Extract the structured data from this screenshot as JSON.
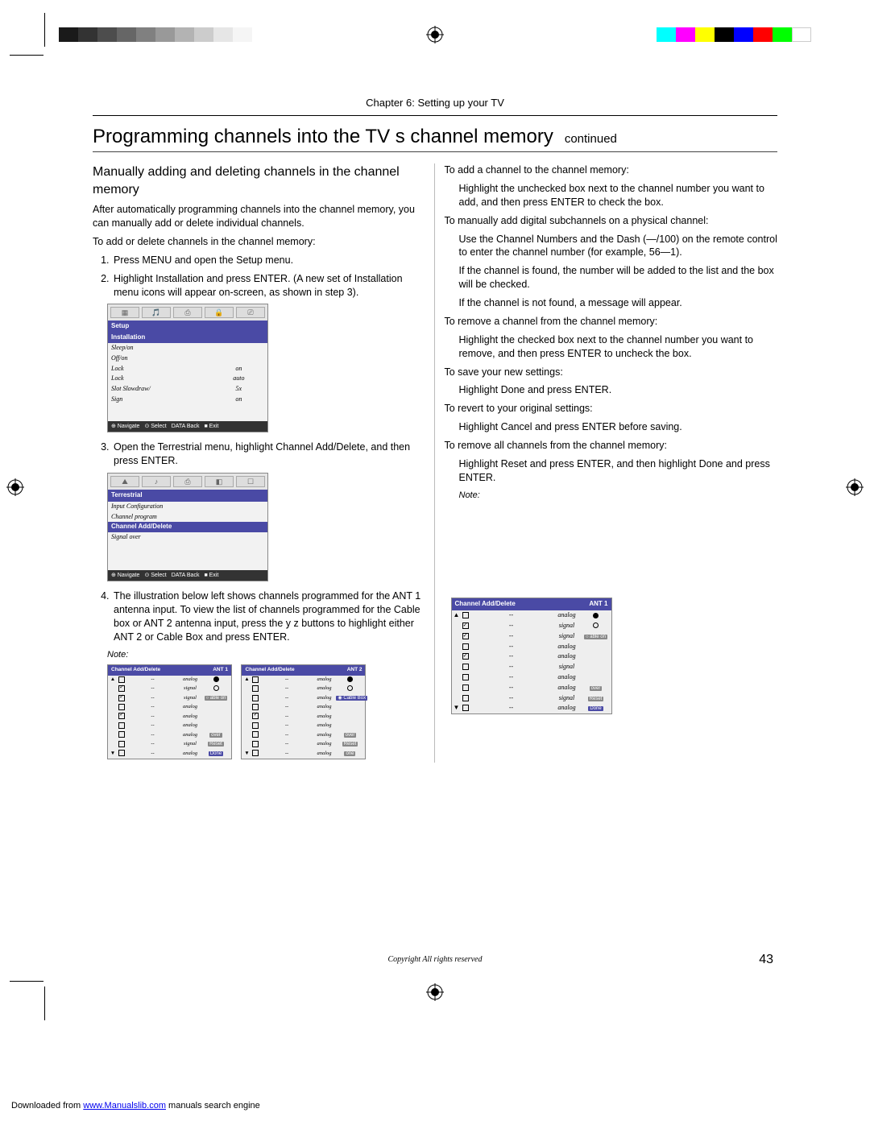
{
  "chapter": "Chapter 6: Setting up your TV",
  "title": "Programming channels into the TV s channel memory",
  "continued": "continued",
  "left": {
    "h3": "Manually adding and deleting channels in the channel memory",
    "intro": "After automatically programming channels into the channel memory, you can manually add or delete individual channels.",
    "lead": "To add or delete channels in the channel memory:",
    "li1": "Press MENU and open the Setup menu.",
    "li2": "Highlight Installation and press ENTER. (A new set of Installation menu icons will appear on-screen, as shown in step 3).",
    "li3": "Open the Terrestrial menu, highlight Channel Add/Delete, and then press ENTER.",
    "li4": "The illustration below left shows channels programmed for the ANT 1 antenna input. To view the list of channels programmed for the Cable box or ANT 2 antenna input, press the y z buttons to highlight either  ANT 2  or  Cable Box  and press ENTER.",
    "note4": "Note:"
  },
  "right": {
    "p1": "To add a channel to the channel memory:",
    "p1b": "Highlight the unchecked box next to the channel number you want to add, and then press ENTER to check the box.",
    "p2": "To manually add digital subchannels on a physical channel:",
    "p2b": "Use the Channel Numbers and the Dash (—/100) on the remote control to enter the channel number (for example, 56—1).",
    "p2c": "If the channel is found, the number will be added to the list and the box will be checked.",
    "p2d": "If the channel is not found, a message will appear.",
    "p3": "To remove a channel from the channel memory:",
    "p3b": "Highlight the checked box next to the channel number you want to remove, and then press ENTER to uncheck the box.",
    "p4": "To save your new settings:",
    "p4b": "Highlight Done and press ENTER.",
    "p5": "To revert to your original settings:",
    "p5b": "Highlight Cancel and press ENTER before saving.",
    "p6": "To remove all channels from the channel memory:",
    "p6b": "Highlight Reset and press ENTER, and then highlight Done and press ENTER.",
    "note": "Note:"
  },
  "menu_setup": {
    "header": "Setup",
    "rows": [
      {
        "c1": "Installation",
        "hl": true
      },
      {
        "c1": "Sleep/on",
        "c2": ""
      },
      {
        "c1": "Off/on",
        "c2": ""
      },
      {
        "c1": "Lock",
        "c2": "on"
      },
      {
        "c1": "Lock",
        "c2": "auto"
      },
      {
        "c1": "Slot Slowdraw/",
        "c2": "5x"
      },
      {
        "c1": "Sign",
        "c2": "on"
      }
    ],
    "footer": [
      "⊕ Navigate",
      "⊙ Select",
      "DATA Back",
      "■ Exit"
    ]
  },
  "menu_terr": {
    "header": "Terrestrial",
    "rows": [
      {
        "c1": "Input Configuration"
      },
      {
        "c1": "Channel program"
      },
      {
        "c1": "Channel Add/Delete",
        "hl": true
      },
      {
        "c1": "Signal over"
      }
    ],
    "footer": [
      "⊕ Navigate",
      "⊙ Select",
      "DATA Back",
      "■ Exit"
    ]
  },
  "table_ant1": {
    "title": "Channel Add/Delete",
    "badge": "ANT 1",
    "rows": [
      {
        "arr": "▲",
        "chk": false,
        "sig": "analog",
        "rb": "sel"
      },
      {
        "chk": true,
        "sig": "signal",
        "rb": "open"
      },
      {
        "chk": true,
        "sig": "signal",
        "rb": "btn",
        "btn": "○ able on"
      },
      {
        "chk": false,
        "sig": "analog"
      },
      {
        "chk": true,
        "sig": "analog"
      },
      {
        "chk": false,
        "sig": "analog"
      },
      {
        "chk": false,
        "sig": "analog",
        "rb": "btn",
        "btn": "over"
      },
      {
        "chk": false,
        "sig": "signal",
        "rb": "btn",
        "btn": "Reset"
      },
      {
        "arr": "▼",
        "chk": false,
        "sig": "analog",
        "rb": "btn",
        "btn": "Done",
        "hl": true
      }
    ]
  },
  "table_ant2": {
    "title": "Channel Add/Delete",
    "badge": "ANT 2",
    "rows": [
      {
        "arr": "▲",
        "chk": false,
        "sig": "analog",
        "rb": "sel"
      },
      {
        "chk": false,
        "sig": "analog",
        "rb": "open"
      },
      {
        "chk": false,
        "sig": "analog",
        "rb": "btn",
        "btn": "◉ Cable Box",
        "hl": true
      },
      {
        "chk": false,
        "sig": "analog"
      },
      {
        "chk": true,
        "sig": "analog"
      },
      {
        "chk": false,
        "sig": "analog"
      },
      {
        "chk": false,
        "sig": "analog",
        "rb": "btn",
        "btn": "over"
      },
      {
        "chk": false,
        "sig": "analog",
        "rb": "btn",
        "btn": "Reset"
      },
      {
        "arr": "▼",
        "chk": false,
        "sig": "analog",
        "rb": "btn",
        "btn": "one"
      }
    ]
  },
  "table_big": {
    "title": "Channel Add/Delete",
    "badge": "ANT 1",
    "rows": [
      {
        "arr": "▲",
        "chk": false,
        "sig": "analog",
        "rb": "sel"
      },
      {
        "chk": true,
        "sig": "signal",
        "rb": "open"
      },
      {
        "chk": true,
        "sig": "signal",
        "rb": "btn",
        "btn": "○ able on"
      },
      {
        "chk": false,
        "sig": "analog"
      },
      {
        "chk": true,
        "sig": "analog"
      },
      {
        "chk": false,
        "sig": "signal"
      },
      {
        "chk": false,
        "sig": "analog"
      },
      {
        "chk": false,
        "sig": "analog",
        "rb": "btn",
        "btn": "over"
      },
      {
        "chk": false,
        "sig": "signal",
        "rb": "btn",
        "btn": "Reset"
      },
      {
        "arr": "▼",
        "chk": false,
        "sig": "analog",
        "rb": "btn",
        "btn": "Done",
        "hl": true
      }
    ]
  },
  "pagenum": "43",
  "copyright": "Copyright   All rights reserved",
  "download_pre": "Downloaded from ",
  "download_link": "www.Manualslib.com",
  "download_post": " manuals search engine"
}
